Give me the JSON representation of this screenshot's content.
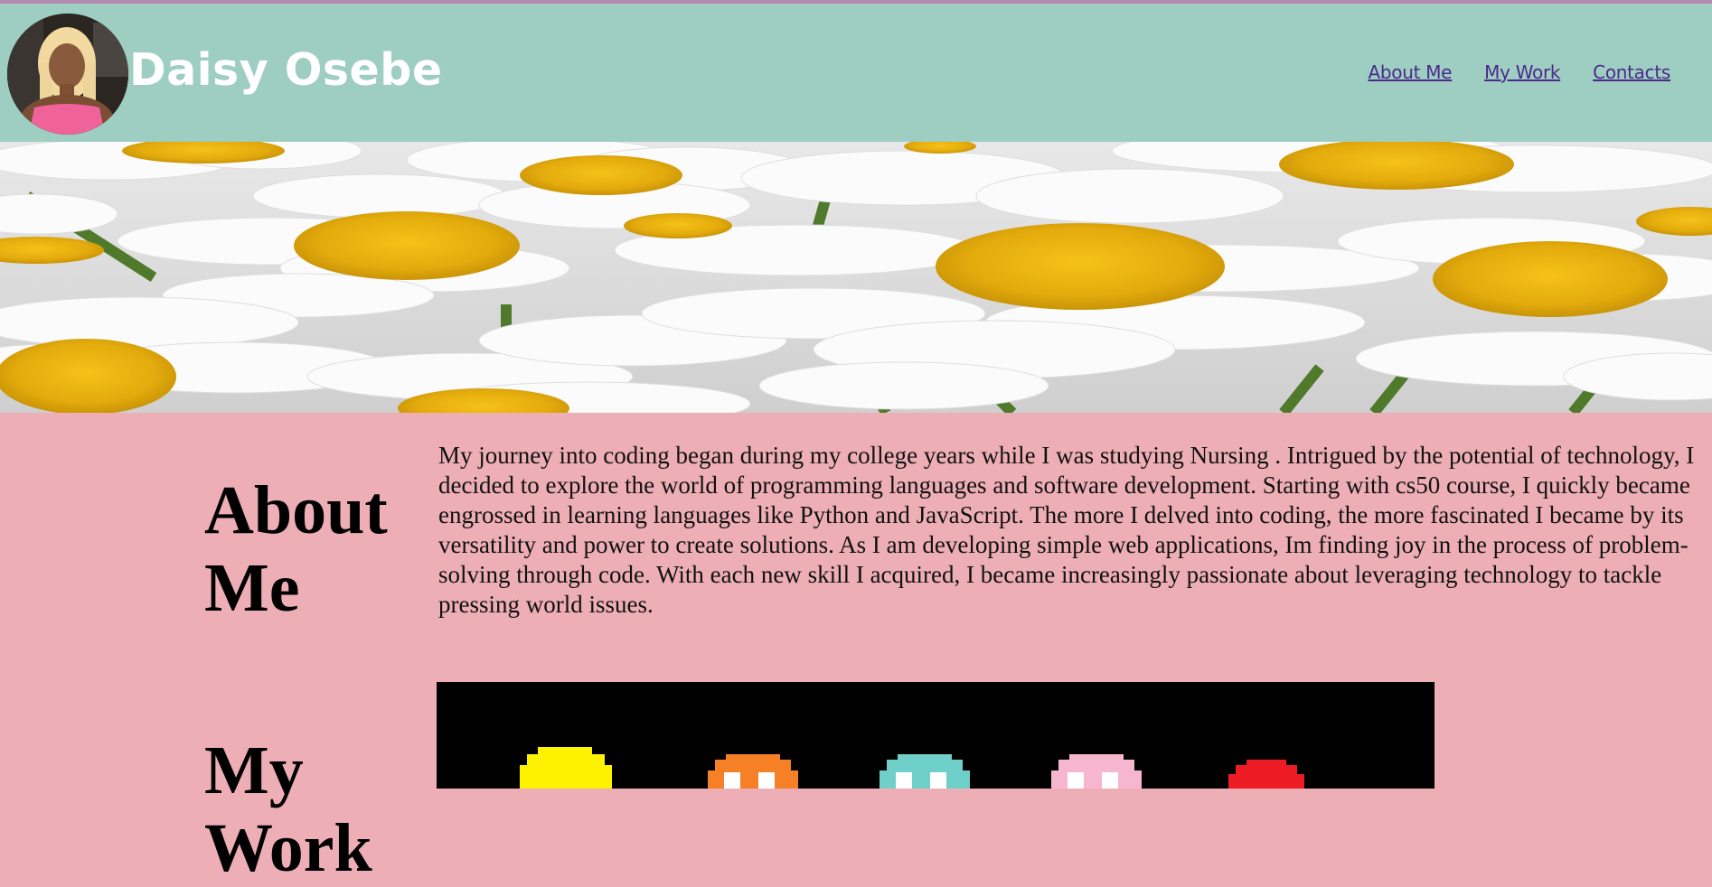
{
  "header": {
    "site_name": "Daisy Osebe",
    "avatar_alt": "Profile photo of Daisy Osebe",
    "nav": [
      {
        "label": "About Me"
      },
      {
        "label": "My Work"
      },
      {
        "label": "Contacts"
      }
    ],
    "colors": {
      "header_bg": "#9ecdc1",
      "nav_link": "#4b2a8c"
    }
  },
  "hero": {
    "description": "Banner photo of white daisies with yellow centers"
  },
  "about": {
    "heading": "About Me",
    "paragraph": "My journey into coding began during my college years while I was studying Nursing . Intrigued by the potential of technology, I decided to explore the world of programming languages and software development. Starting with cs50 course, I quickly became engrossed in learning languages like Python and JavaScript. The more I delved into coding, the more fascinated I became by its versatility and power to create solutions. As I am developing simple web applications, Im finding joy in the process of problem-solving through code. With each new skill I acquired, I became increasingly passionate about leveraging technology to tackle pressing world issues."
  },
  "work": {
    "heading": "My Work",
    "image_description": "Pixel art of colorful ghost characters on black background",
    "ghost_colors": [
      "#fff200",
      "#f58025",
      "#6fcfc9",
      "#f7b6cf",
      "#ed1c24"
    ]
  },
  "page": {
    "background": "#edaeb5"
  }
}
